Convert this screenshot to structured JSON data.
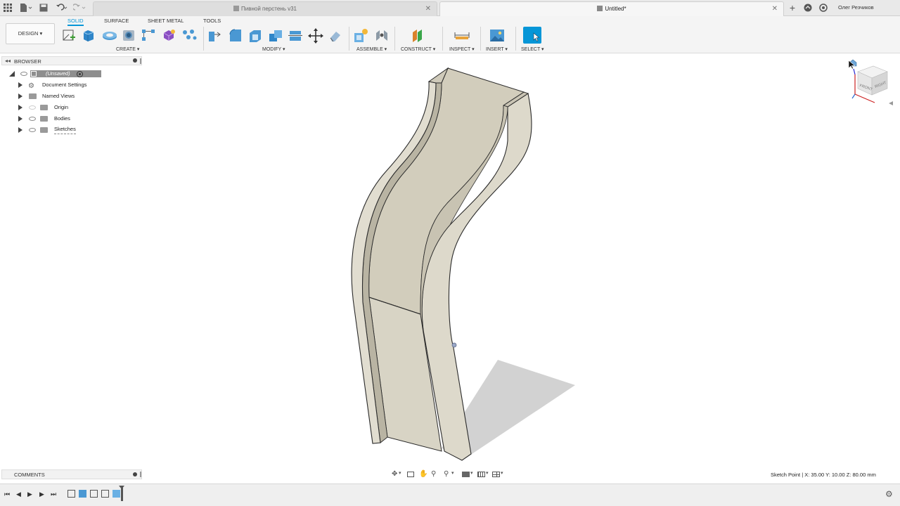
{
  "titlebar": {
    "tabs": [
      {
        "label": "Пивной перстень v31",
        "active": false
      },
      {
        "label": "Untitled*",
        "active": true
      }
    ],
    "user_name": "Олег Резчиков"
  },
  "toolbar": {
    "workspace_button": "DESIGN ▾",
    "workspace_tabs": [
      "SOLID",
      "SURFACE",
      "SHEET METAL",
      "TOOLS"
    ],
    "groups": {
      "create": "CREATE ▾",
      "modify": "MODIFY ▾",
      "assemble": "ASSEMBLE ▾",
      "construct": "CONSTRUCT ▾",
      "inspect": "INSPECT ▾",
      "insert": "INSERT ▾",
      "select": "SELECT ▾"
    }
  },
  "browser": {
    "title": "BROWSER",
    "root_label": "(Unsaved)",
    "items": [
      "Document Settings",
      "Named Views",
      "Origin",
      "Bodies",
      "Sketches"
    ]
  },
  "comments": {
    "title": "COMMENTS"
  },
  "viewcube": {
    "front": "FRONT",
    "right": "RIGHT"
  },
  "status": {
    "text": "Sketch Point | X: 35.00 Y: 10.00 Z: 80.00 mm"
  },
  "colors": {
    "accent": "#0696d7",
    "body_face": "#ddd9cb",
    "body_inner": "#cbc6b5",
    "shadow": "#d4d4d4"
  }
}
